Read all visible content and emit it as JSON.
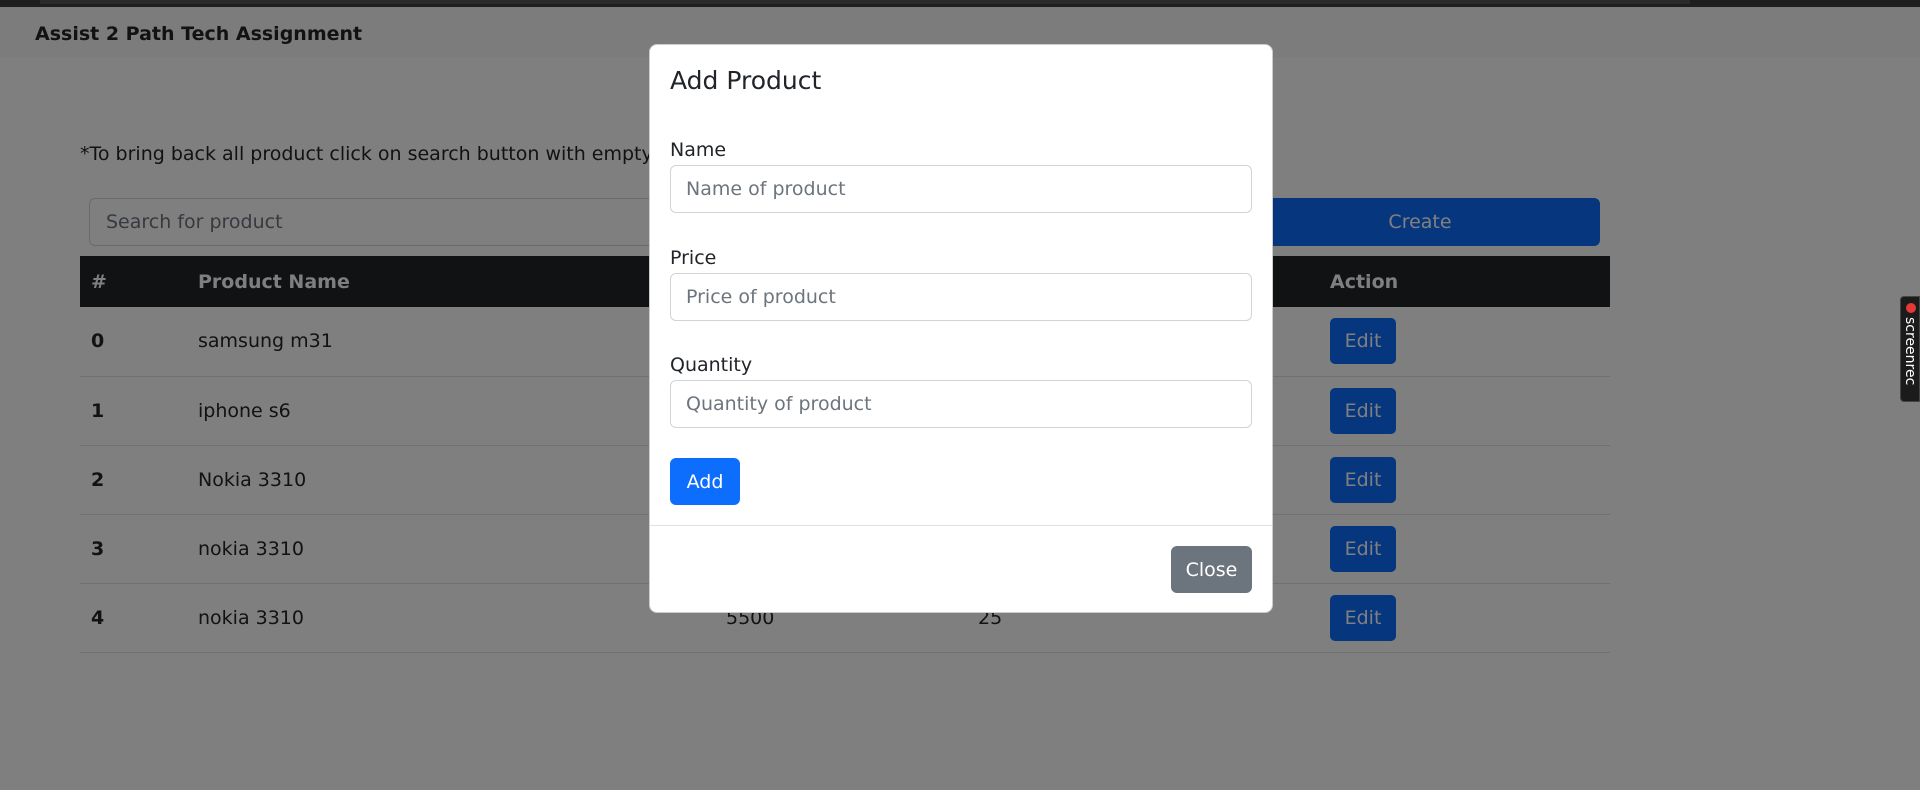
{
  "navbar": {
    "brand": "Assist 2 Path Tech Assignment"
  },
  "note": "*To bring back all product click on search button with empty text",
  "search": {
    "placeholder": "Search for product"
  },
  "create_label": "Create",
  "table": {
    "headers": [
      "#",
      "Product Name",
      "",
      "",
      "Action"
    ],
    "rows": [
      {
        "num": "0",
        "name": "samsung m31",
        "price": "",
        "quantity": "",
        "action": "Edit"
      },
      {
        "num": "1",
        "name": "iphone s6",
        "price": "",
        "quantity": "",
        "action": "Edit"
      },
      {
        "num": "2",
        "name": "Nokia 3310",
        "price": "",
        "quantity": "",
        "action": "Edit"
      },
      {
        "num": "3",
        "name": "nokia 3310",
        "price": "",
        "quantity": "",
        "action": "Edit"
      },
      {
        "num": "4",
        "name": "nokia 3310",
        "price": "5500",
        "quantity": "25",
        "action": "Edit"
      }
    ]
  },
  "modal": {
    "title": "Add Product",
    "fields": [
      {
        "label": "Name",
        "placeholder": "Name of product"
      },
      {
        "label": "Price",
        "placeholder": "Price of product"
      },
      {
        "label": "Quantity",
        "placeholder": "Quantity of product"
      }
    ],
    "add_label": "Add",
    "close_label": "Close"
  },
  "recorder_badge": {
    "text": "screenrec",
    "icon": "record-dot-icon"
  },
  "colors": {
    "primary": "#0d6efd",
    "secondary": "#6c757d",
    "dark": "#212529",
    "backdrop": "rgba(0,0,0,0.5)"
  }
}
